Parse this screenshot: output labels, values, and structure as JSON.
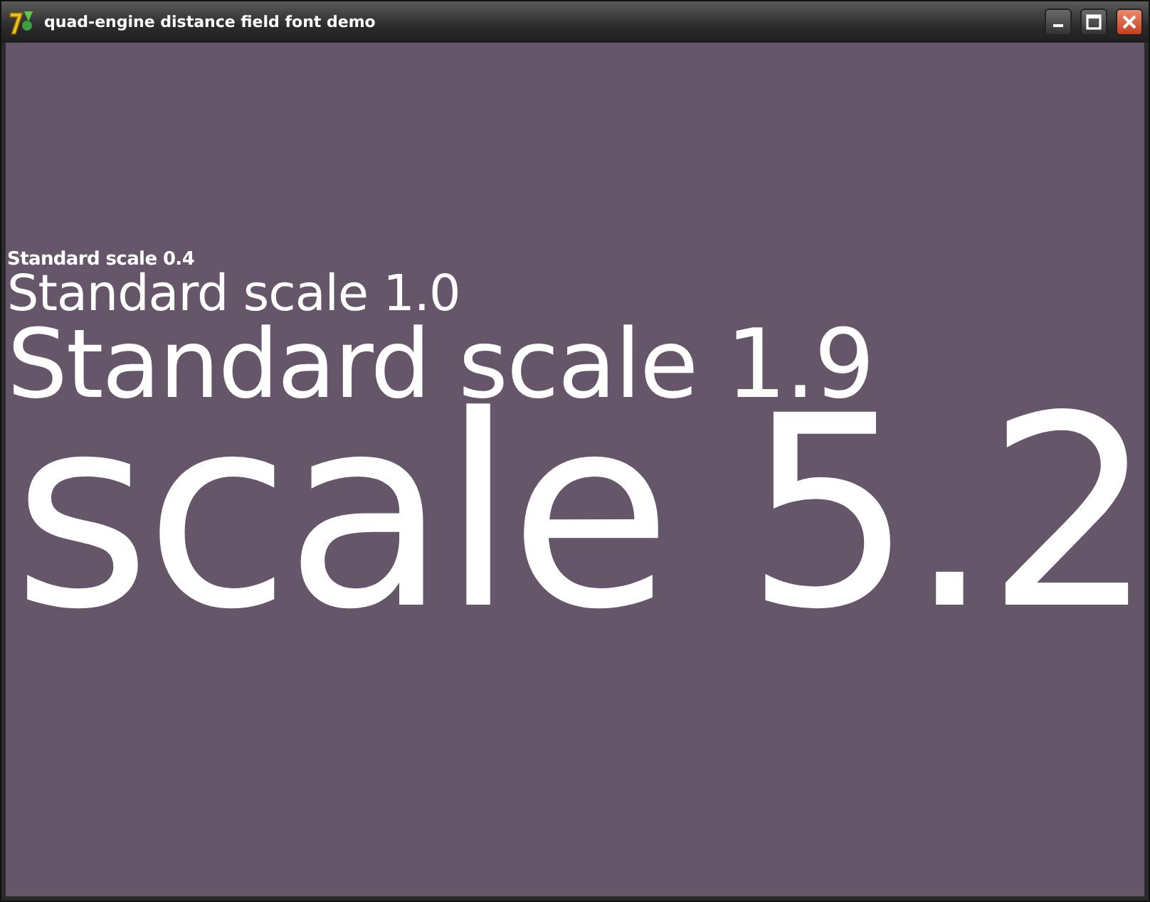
{
  "window": {
    "title": "quad-engine distance field font demo"
  },
  "lines": [
    {
      "text": "Standard scale 0.4",
      "kind": "s04"
    },
    {
      "text": "Standard scale 1.0",
      "kind": "s10"
    },
    {
      "text": "Standard scale 1.9",
      "kind": "s19"
    },
    {
      "text": "scale 5.2",
      "kind": "s52"
    }
  ]
}
